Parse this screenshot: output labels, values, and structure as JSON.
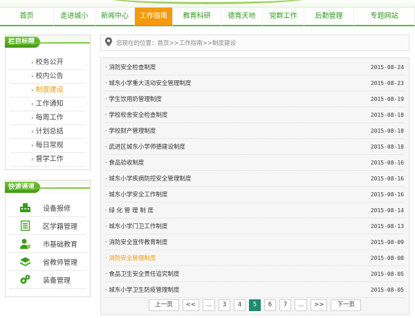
{
  "nav": {
    "items": [
      "首页",
      "走进城小",
      "新闻中心",
      "工作指南",
      "教育科研",
      "德育天地",
      "党群工作",
      "后勤管理",
      "专题网站"
    ],
    "active_index": 3
  },
  "sidebar": {
    "column_title": "栏目标题",
    "items": [
      "校务公开",
      "校内公告",
      "制度建设",
      "工作通知",
      "每周工作",
      "计划总结",
      "每日常规",
      "督学工作"
    ],
    "active_index": 2,
    "quick_title": "快速通道",
    "quick_links": [
      {
        "label": "设备报修",
        "icon": "building-icon"
      },
      {
        "label": "区学籍管理",
        "icon": "document-icon"
      },
      {
        "label": "市基础教育",
        "icon": "person-icon"
      },
      {
        "label": "省教师管理",
        "icon": "layers-icon"
      },
      {
        "label": "装备管理",
        "icon": "gears-icon"
      }
    ]
  },
  "breadcrumb": "您现在的位置：首页>>工作指南>>制度建设",
  "articles": [
    {
      "title": "消防安全检查制度",
      "date": "2015-08-24"
    },
    {
      "title": "城东小学重大活动安全管理制度",
      "date": "2015-08-23"
    },
    {
      "title": "学生饮用奶管理制度",
      "date": "2015-08-19"
    },
    {
      "title": "学校校舍安全检查制度",
      "date": "2015-08-18"
    },
    {
      "title": "学校财产管理制度",
      "date": "2015-08-18"
    },
    {
      "title": "武进区城东小学师德建设制度",
      "date": "2015-08-18"
    },
    {
      "title": "食品验收制度",
      "date": "2015-08-16"
    },
    {
      "title": "城东小学疾病防控安全管理制度",
      "date": "2015-08-16"
    },
    {
      "title": "城东小学安全工作制度",
      "date": "2015-08-16"
    },
    {
      "title": "绿 化 管 理 制 度",
      "date": "2015-08-14"
    },
    {
      "title": "城东小学门卫工作制度",
      "date": "2015-08-13"
    },
    {
      "title": "消防安全宣传教育制度",
      "date": "2015-08-09"
    },
    {
      "title": "消防安全管理制度",
      "date": "2015-08-08",
      "highlight": true
    },
    {
      "title": "食品卫生安全责任追究制度",
      "date": "2015-08-05"
    },
    {
      "title": "城东小学卫生防疫管理制度",
      "date": "2015-08-05"
    }
  ],
  "pagination": {
    "prev": "上一页",
    "first": "<<",
    "ellipsis": "...",
    "pages": [
      "3",
      "4",
      "5",
      "6",
      "7"
    ],
    "current": "5",
    "last": ">>",
    "next": "下一页"
  },
  "colors": {
    "brand_green": "#3f9a14",
    "active_orange": "#f49a0d",
    "pager_active": "#1f8a6f"
  }
}
